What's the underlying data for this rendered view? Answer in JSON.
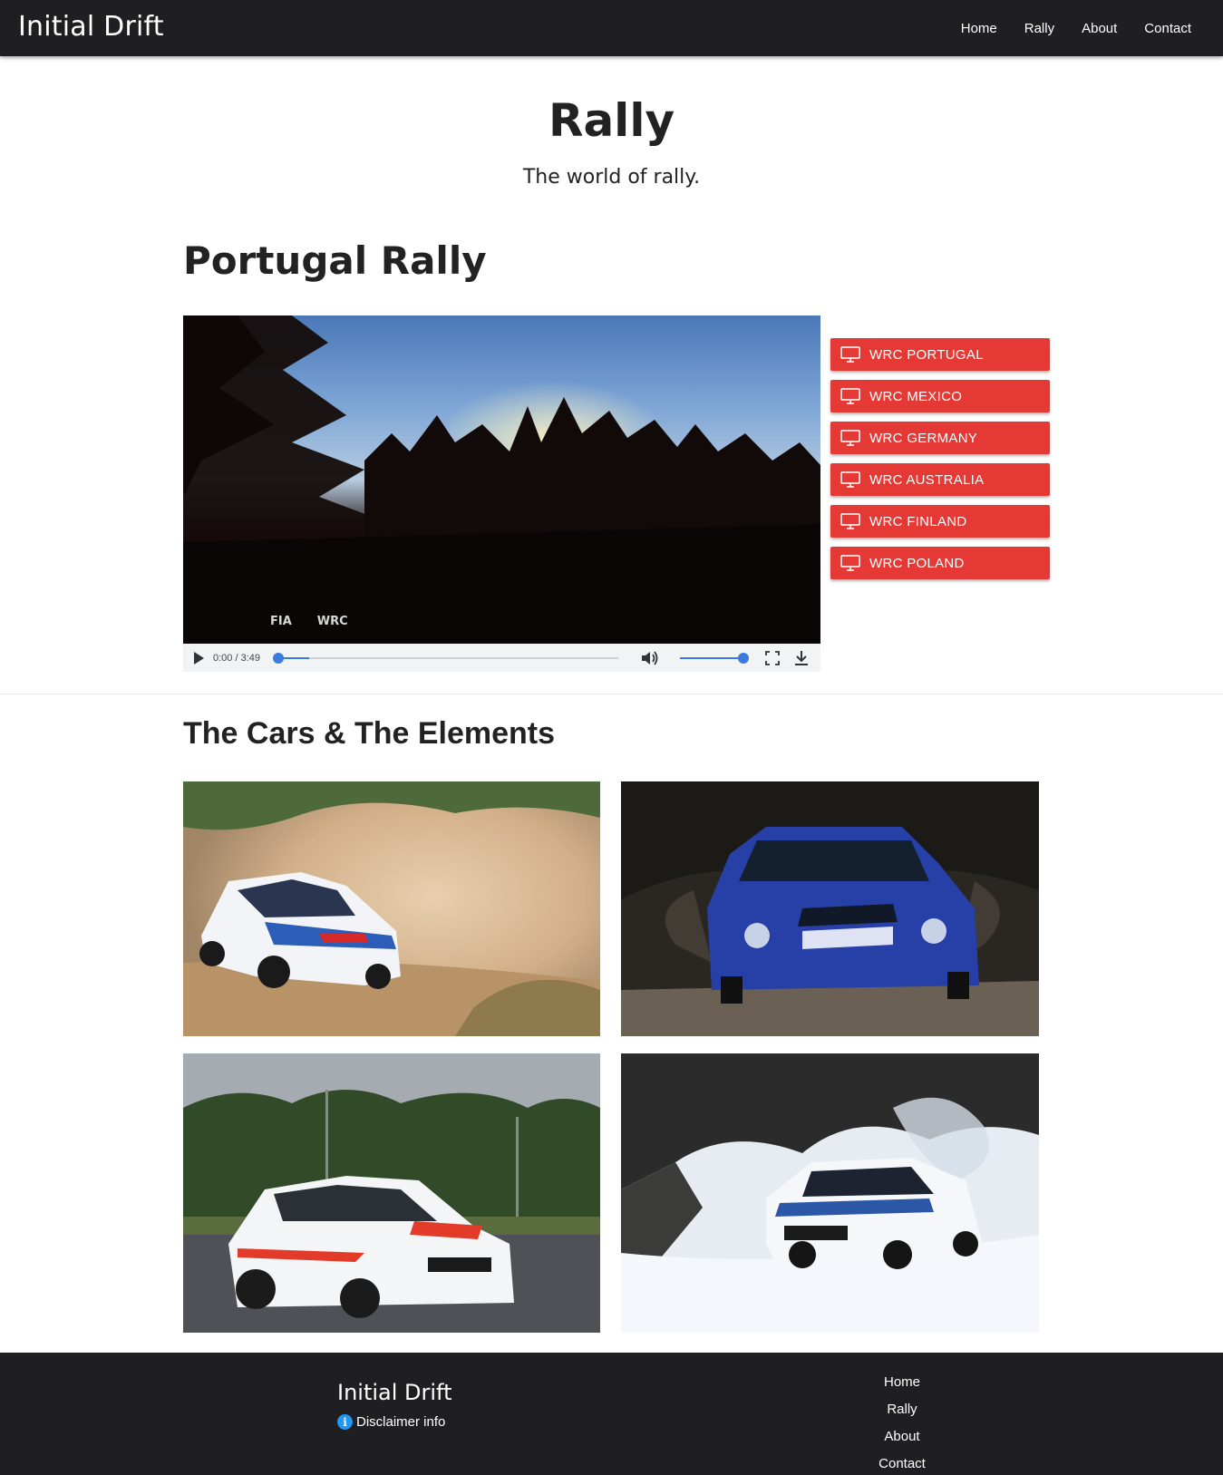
{
  "navbar": {
    "brand": "Initial Drift",
    "links": [
      "Home",
      "Rally",
      "About",
      "Contact"
    ]
  },
  "header": {
    "title": "Rally",
    "subtitle": "The world of rally."
  },
  "video_section": {
    "title": "Portugal Rally",
    "video": {
      "logo_left": "FIA",
      "logo_right": "WRC",
      "time": "0:00 / 3:49",
      "progress": 0,
      "volume": 1.0
    },
    "buttons": [
      {
        "label": "WRC PORTUGAL",
        "icon": "monitor-icon"
      },
      {
        "label": "WRC MEXICO",
        "icon": "monitor-icon"
      },
      {
        "label": "WRC GERMANY",
        "icon": "monitor-icon"
      },
      {
        "label": "WRC AUSTRALIA",
        "icon": "monitor-icon"
      },
      {
        "label": "WRC FINLAND",
        "icon": "monitor-icon"
      },
      {
        "label": "WRC POLAND",
        "icon": "monitor-icon"
      }
    ],
    "button_color": "#e53935"
  },
  "gallery": {
    "title": "The Cars & The Elements"
  },
  "footer": {
    "brand": "Initial Drift",
    "disclaimer": "Disclaimer info",
    "links": [
      "Home",
      "Rally",
      "About",
      "Contact"
    ]
  }
}
